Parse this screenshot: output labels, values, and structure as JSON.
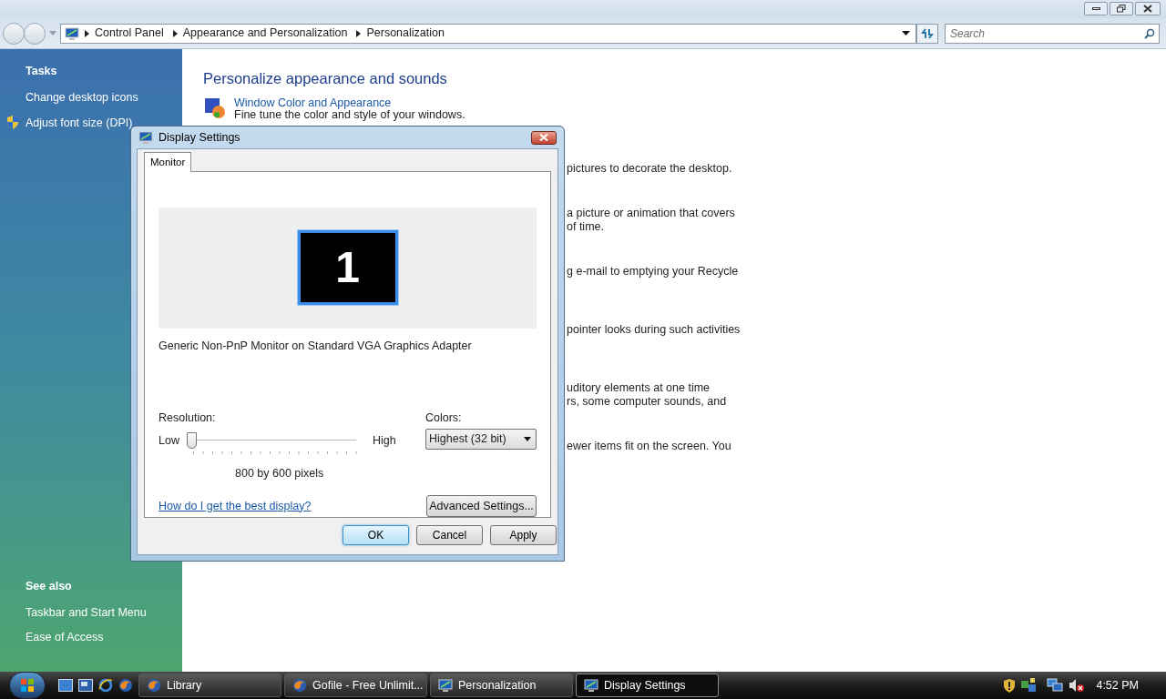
{
  "address_bar": {
    "crumbs": [
      "Control Panel",
      "Appearance and Personalization",
      "Personalization"
    ]
  },
  "search": {
    "placeholder": "Search"
  },
  "sidebar": {
    "tasks_title": "Tasks",
    "tasks": [
      {
        "label": "Change desktop icons",
        "kind": "plain"
      },
      {
        "label": "Adjust font size (DPI)",
        "kind": "shield"
      }
    ],
    "see_also_title": "See also",
    "see_also": [
      "Taskbar and Start Menu",
      "Ease of Access"
    ]
  },
  "main": {
    "heading": "Personalize appearance and sounds",
    "first_item": {
      "title": "Window Color and Appearance",
      "description": "Fine tune the color and style of your windows."
    },
    "fragments": [
      [
        "pictures to decorate the desktop."
      ],
      [
        "a picture or animation that covers",
        "of time."
      ],
      [
        "g e-mail to emptying your Recycle"
      ],
      [
        "pointer looks during such activities"
      ],
      [
        "uditory elements at one time",
        "rs, some computer sounds, and"
      ],
      [
        "ewer items fit on the screen. You"
      ]
    ]
  },
  "dialog": {
    "title": "Display Settings",
    "tabs": [
      {
        "label": "Monitor",
        "selected": true
      }
    ],
    "monitor_number": "1",
    "monitor_name": "Generic Non-PnP Monitor on Standard VGA Graphics Adapter",
    "resolution_label": "Resolution:",
    "low": "Low",
    "high": "High",
    "resolution": {
      "level": 0
    },
    "resolution_value": "800 by 600 pixels",
    "colors_label": "Colors:",
    "colors_value": "Highest (32 bit)",
    "help_link": "How do I get the best display?",
    "advanced_button": "Advanced Settings...",
    "buttons": [
      {
        "label": "OK",
        "kind": "default"
      },
      {
        "label": "Cancel",
        "kind": "normal"
      },
      {
        "label": "Apply",
        "kind": "normal"
      }
    ]
  },
  "taskbar": {
    "tasks": [
      {
        "label": "Library",
        "kind": "firefox",
        "selected": false
      },
      {
        "label": "Gofile - Free Unlimit...",
        "kind": "firefox",
        "selected": false
      },
      {
        "label": "Personalization",
        "kind": "monitor",
        "selected": false
      },
      {
        "label": "Display Settings",
        "kind": "display",
        "selected": true
      }
    ],
    "clock": "4:52 PM"
  }
}
